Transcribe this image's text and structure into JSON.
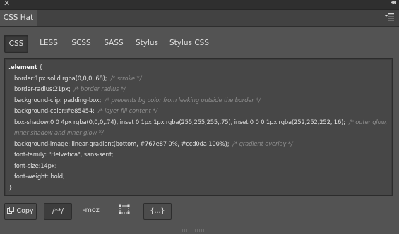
{
  "titlebar": {
    "close_icon": "close-icon",
    "collapse_icon": "collapse-double-arrow-icon"
  },
  "panel": {
    "tab_label": "CSS Hat",
    "menu_icon": "panel-menu-icon"
  },
  "lang_tabs": [
    "CSS",
    "LESS",
    "SCSS",
    "SASS",
    "Stylus",
    "Stylus CSS"
  ],
  "active_tab": "CSS",
  "code": {
    "selector": ".element",
    "open_brace": "{",
    "close_brace": "}",
    "lines": [
      {
        "decl": "border:1px solid rgba(0,0,0,.68);",
        "comment": "/* stroke */"
      },
      {
        "decl": "border-radius:21px;",
        "comment": "/* border radius */"
      },
      {
        "decl": "background-clip: padding-box;",
        "comment": "/* prevents bg color from leaking outside the border */"
      },
      {
        "decl": "background-color:#e85454;",
        "comment": "/* layer fill content */"
      },
      {
        "decl": "box-shadow:0 0 4px rgba(0,0,0,.74), inset 0 1px 1px rgba(255,255,255,.75), inset 0 0 0 1px rgba(252,252,252,.16);",
        "comment": "/* outer glow, inner shadow and inner glow */"
      },
      {
        "decl": "background-image: linear-gradient(bottom, #767e87 0%, #ccd0da 100%);",
        "comment": "/* gradient overlay */"
      },
      {
        "decl": "font-family: \"Helvetica\", sans-serif;",
        "comment": ""
      },
      {
        "decl": "font-size:14px;",
        "comment": ""
      },
      {
        "decl": "font-weight: bold;",
        "comment": ""
      }
    ]
  },
  "toolbar": {
    "copy_label": "Copy",
    "copy_icon": "copy-icon",
    "comments_label": "/**/",
    "moz_label": "-moz",
    "bounds_icon": "bounding-box-icon",
    "braces_label": "{...}"
  },
  "colors": {
    "panel_bg": "#535353",
    "code_bg": "#474747",
    "comment": "#8e8e8e"
  }
}
